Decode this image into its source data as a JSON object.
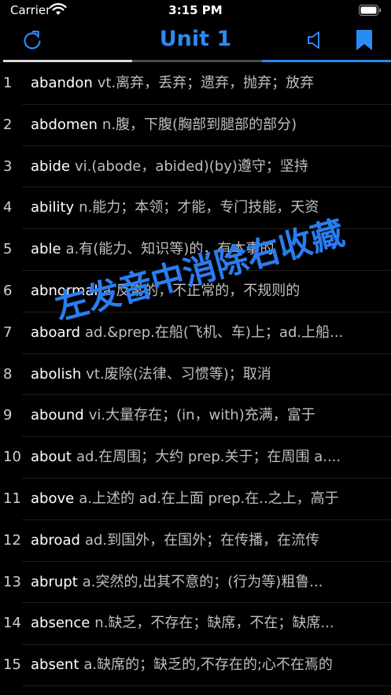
{
  "status_bar": {
    "carrier": "Carrier",
    "time": "3:15 PM"
  },
  "nav": {
    "title": "Unit 1"
  },
  "progress_colors": [
    "#d9d9d9",
    "#4a4a4a",
    "#2a8bf2"
  ],
  "accent_color": "#2a8bf2",
  "icons": {
    "refresh": "refresh-icon",
    "sound": "speaker-icon",
    "bookmark": "bookmark-icon",
    "wifi": "wifi-icon",
    "battery": "battery-icon"
  },
  "overlay_text": "左发音中消除右收藏",
  "words": [
    {
      "num": "1",
      "word": "abandon",
      "def": "vt.离弃，丢弃；遗弃，抛弃；放弃"
    },
    {
      "num": "2",
      "word": "abdomen",
      "def": "n.腹，下腹(胸部到腿部的部分)"
    },
    {
      "num": "3",
      "word": "abide",
      "def": "vi.(abode，abided)(by)遵守；坚持"
    },
    {
      "num": "4",
      "word": "ability",
      "def": "n.能力；本领；才能，专门技能，天资"
    },
    {
      "num": "5",
      "word": "able",
      "def": "a.有(能力、知识等)的，有本事的"
    },
    {
      "num": "6",
      "word": "abnormal",
      "def": "a.反常的，不正常的，不规则的"
    },
    {
      "num": "7",
      "word": "aboard",
      "def": "ad.&prep.在船(飞机、车)上；ad.上船..."
    },
    {
      "num": "8",
      "word": "abolish",
      "def": "vt.废除(法律、习惯等)；取消"
    },
    {
      "num": "9",
      "word": "abound",
      "def": "vi.大量存在；(in，with)充满，富于"
    },
    {
      "num": "10",
      "word": "about",
      "def": "ad.在周围；大约 prep.关于；在周围 a...."
    },
    {
      "num": "11",
      "word": "above",
      "def": "a.上述的 ad.在上面  prep.在..之上，高于"
    },
    {
      "num": "12",
      "word": "abroad",
      "def": "ad.到国外，在国外；在传播，在流传"
    },
    {
      "num": "13",
      "word": "abrupt",
      "def": "a.突然的,出其不意的；(行为等)粗鲁..."
    },
    {
      "num": "14",
      "word": "absence",
      "def": "n.缺乏，不存在；缺席，不在；缺席..."
    },
    {
      "num": "15",
      "word": "absent",
      "def": "a.缺席的；缺乏的,不存在的;心不在焉的"
    }
  ]
}
